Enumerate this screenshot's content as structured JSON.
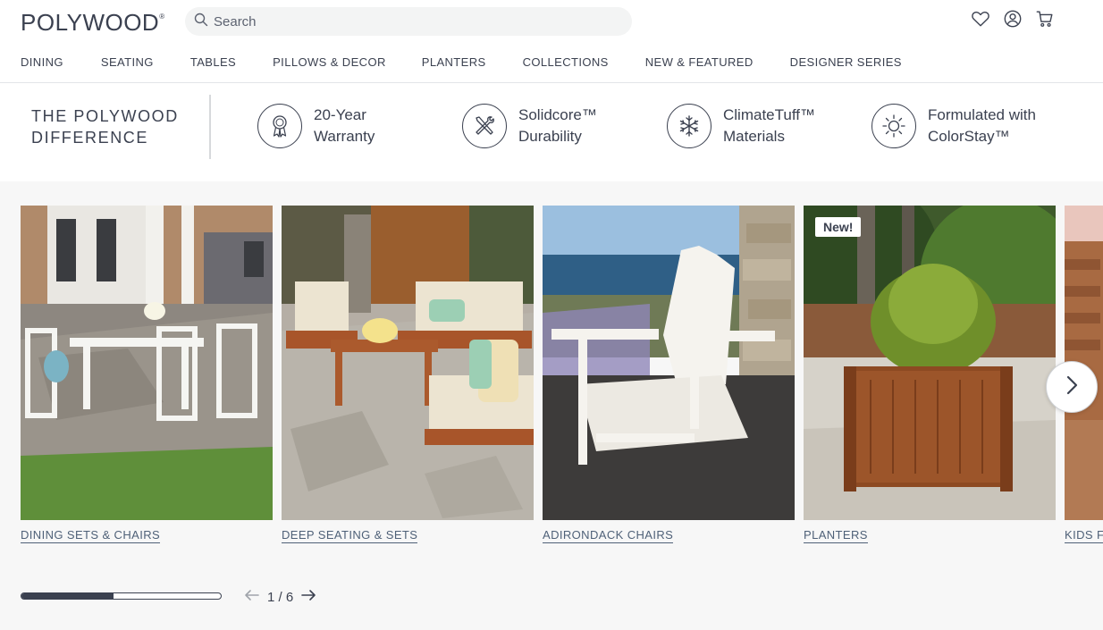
{
  "brand": {
    "name": "POLYWOOD",
    "trademark": "®"
  },
  "search": {
    "placeholder": "Search"
  },
  "header_icons": [
    "heart-icon",
    "account-icon",
    "cart-icon"
  ],
  "nav": [
    {
      "label": "DINING"
    },
    {
      "label": "SEATING"
    },
    {
      "label": "TABLES"
    },
    {
      "label": "PILLOWS & DECOR"
    },
    {
      "label": "PLANTERS"
    },
    {
      "label": "COLLECTIONS"
    },
    {
      "label": "NEW & FEATURED"
    },
    {
      "label": "DESIGNER SERIES"
    }
  ],
  "difference": {
    "title_line1": "THE POLYWOOD",
    "title_line2": "DIFFERENCE",
    "features": [
      {
        "line1": "20-Year",
        "line2": "Warranty",
        "icon": "award-ribbon-icon"
      },
      {
        "line1": "Solidcore™",
        "line2": "Durability",
        "icon": "tools-icon"
      },
      {
        "line1": "ClimateTuff™",
        "line2": "Materials",
        "icon": "snowflake-icon"
      },
      {
        "line1": "Formulated with",
        "line2": "ColorStay™",
        "icon": "sun-icon"
      }
    ]
  },
  "carousel": {
    "cards": [
      {
        "label": "DINING SETS & CHAIRS",
        "badge": ""
      },
      {
        "label": "DEEP SEATING & SETS",
        "badge": ""
      },
      {
        "label": "ADIRONDACK CHAIRS",
        "badge": ""
      },
      {
        "label": "PLANTERS",
        "badge": "New!"
      },
      {
        "label": "KIDS F",
        "badge": ""
      }
    ],
    "progress": 0.46,
    "page_current": "1",
    "page_total": "6",
    "page_text": "1 / 6"
  },
  "colors": {
    "text": "#3b4150",
    "link": "#4f6178",
    "band_bg": "#f7f7f7"
  }
}
